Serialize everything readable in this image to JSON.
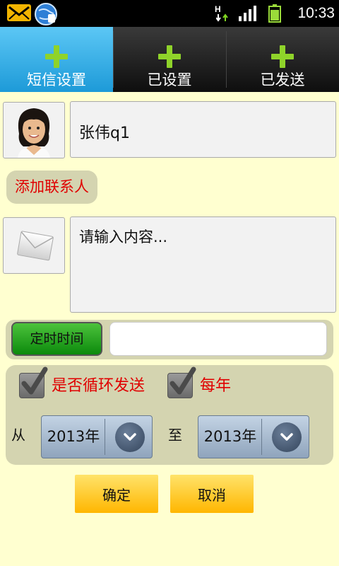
{
  "status_bar": {
    "time": "10:33",
    "network_indicator": "H",
    "icons": [
      "mail-icon",
      "globe-app-icon",
      "network-activity-icon",
      "signal-icon",
      "battery-icon"
    ]
  },
  "tabs": [
    {
      "label": "短信设置",
      "active": true
    },
    {
      "label": "已设置",
      "active": false
    },
    {
      "label": "已发送",
      "active": false
    }
  ],
  "contact": {
    "name": "张伟q1",
    "add_contact_label": "添加联系人"
  },
  "message": {
    "placeholder": "请输入内容..."
  },
  "timer": {
    "button_label": "定时时间",
    "value": ""
  },
  "loop": {
    "repeat_label": "是否循环发送",
    "repeat_checked": true,
    "yearly_label": "每年",
    "yearly_checked": true,
    "from_label": "从",
    "to_label": "至",
    "from_value": "2013年",
    "to_value": "2013年"
  },
  "actions": {
    "confirm_label": "确定",
    "cancel_label": "取消"
  },
  "colors": {
    "background": "#ffffd0",
    "accent_red": "#e00000",
    "tab_active": "#1d9ad8",
    "button_yellow": "#ffc800",
    "timer_green": "#1a9a1a"
  }
}
